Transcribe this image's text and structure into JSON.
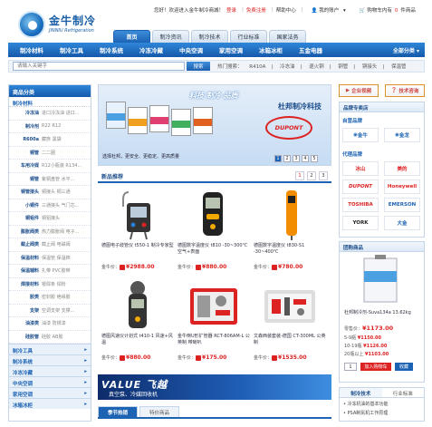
{
  "logo": {
    "name_cn": "金牛制冷",
    "name_en": "JINNIU Refrigeration"
  },
  "topbar": {
    "greeting": "您好！欢迎进入金牛制冷商城！",
    "login": "登录",
    "register": "免费注册",
    "help": "帮助中心",
    "account": "我的账户",
    "cart_prefix": "购物车内有",
    "cart_count": "0",
    "cart_suffix": "件商品"
  },
  "tabs": [
    "首页",
    "制冷资讯",
    "制冷技术",
    "行业标准",
    "国家法务"
  ],
  "nav": {
    "items": [
      "制冷材料",
      "制冷工具",
      "制冷系统",
      "冷冻冷藏",
      "中央空调",
      "家用空调",
      "冰箱冰柜",
      "五金电器"
    ],
    "all": "全部分类"
  },
  "search": {
    "placeholder": "请输入关键字",
    "button": "搜索",
    "hot_label": "热门搜索：",
    "hot": [
      "R410A",
      "冷冻油",
      "退火铜",
      "铜管",
      "铜接头",
      "保温管"
    ]
  },
  "sidebar": {
    "title": "商品分类",
    "group1": "制冷材料",
    "rows": [
      {
        "k": "冷冻油",
        "v": "进口冷冻油 进口..."
      },
      {
        "k": "制冷剂",
        "v": "R22 R12"
      },
      {
        "k": "R600a",
        "v": "藏族 黑袋"
      },
      {
        "k": "铜管",
        "v": "二二圈"
      },
      {
        "k": "车用冷媒",
        "v": "R12小瓶装 R134..."
      },
      {
        "k": "铜管",
        "v": "紫铜盘管 水平..."
      },
      {
        "k": "铜管接头",
        "v": "铜接头 铜三通"
      },
      {
        "k": "小铜件",
        "v": "三通接头 气门芯..."
      },
      {
        "k": "铜铝件",
        "v": "铜铝接头"
      },
      {
        "k": "膨胀阀类",
        "v": "热力膨胀阀 电子..."
      },
      {
        "k": "截止阀类",
        "v": "截止阀 电磁阀"
      },
      {
        "k": "保温材料",
        "v": "保温管 保温棉"
      },
      {
        "k": "保温辅料",
        "v": "扎带 PVC胶带"
      },
      {
        "k": "焊接材料",
        "v": "银焊条 焊粉"
      },
      {
        "k": "胶类",
        "v": "密封胶 绝缘胶"
      },
      {
        "k": "支架",
        "v": "空调支架 支撑..."
      },
      {
        "k": "油漆类",
        "v": "油漆 防锈漆"
      },
      {
        "k": "硅胶管",
        "v": "硅胶 AB胶"
      }
    ],
    "bottom": [
      "制冷工具",
      "制冷系统",
      "冷冻冷藏",
      "中央空调",
      "家用空调",
      "冰箱冰柜"
    ]
  },
  "banner": {
    "brand": "杜邦制冷科技",
    "logo": "DUPONT",
    "caption": "选择杜邦，更安全、更稳定、更高质量",
    "overlay": "科技 制冷 品质",
    "pages": [
      "1",
      "2",
      "3",
      "4",
      "5"
    ]
  },
  "products": {
    "title": "新品推荐",
    "pages": [
      "1",
      "2",
      "3"
    ],
    "items": [
      {
        "name": "德图电子歧管仪 t550-1 制冷专家型",
        "price": "¥2988.00"
      },
      {
        "name": "德图数字温度仪 t810 -30~300℃ 空气+表面",
        "price": "¥880.00"
      },
      {
        "name": "德图数字温度仪 t830-S1 -30~400℃",
        "price": "¥780.00"
      },
      {
        "name": "德图风速仪计划式 t410-1 风速+风温",
        "price": "¥880.00"
      },
      {
        "name": "金牛倒U形扩管器 RCT-806AM-L 公英制 带喇叭",
        "price": "¥175.00"
      },
      {
        "name": "文森西装套装-德国 CT-300ML 公英制",
        "price": "¥1535.00"
      }
    ]
  },
  "ad": {
    "brand": "VALUE 飞越",
    "slogan": "真空泵、冷媒回收机"
  },
  "bottom_tabs": [
    "季节热销",
    "特价商品"
  ],
  "right": {
    "buttons": [
      "企业视频",
      "技术咨询"
    ],
    "shop_title": "品牌专卖店",
    "self_brand": "自营品牌",
    "self_logos": [
      "金牛",
      "金龙"
    ],
    "agent": "代理品牌",
    "agent_logos": [
      "冰山",
      "美的",
      "DUPONT",
      "Honeywell",
      "TOSHIBA",
      "EMERSON",
      "YORK",
      "大金"
    ],
    "group_title": "团购商品",
    "group_name": "杜邦制冷剂-Suva134a 13.62kg",
    "group_price_label": "零售价：",
    "group_price": "¥1173.00",
    "group_tiers": [
      {
        "q": "5-9瓶",
        "p": "¥1150.00"
      },
      {
        "q": "10-19瓶",
        "p": "¥1126.00"
      },
      {
        "q": "20瓶以上",
        "p": "¥1103.00"
      }
    ],
    "qty": "1",
    "add_cart": "加入购物车",
    "fav": "收藏",
    "tech_tabs": [
      "制冷技术",
      "行业标准"
    ],
    "news": [
      "冷冻机油的基本功能",
      "PSA制氮机工作原理"
    ]
  }
}
